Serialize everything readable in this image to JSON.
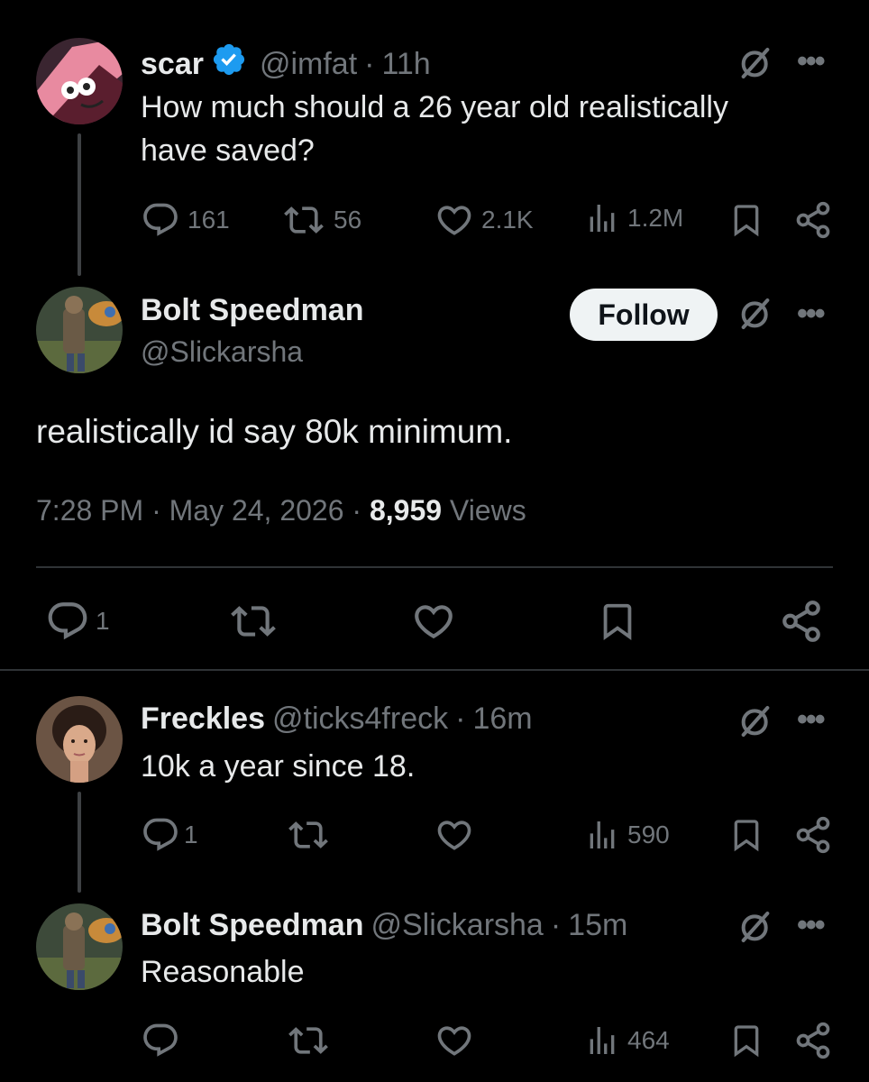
{
  "tweet1": {
    "name": "scar",
    "handle": "@imfat",
    "sep": "·",
    "time": "11h",
    "text_line1": "How much should a 26 year old realistically",
    "text_line2": "have saved?",
    "replies": "161",
    "reposts": "56",
    "likes": "2.1K",
    "views": "1.2M"
  },
  "main_tweet": {
    "name": "Bolt Speedman",
    "handle": "@Slickarsha",
    "follow_label": "Follow",
    "text": "realistically id say 80k minimum.",
    "time": "7:28 PM",
    "sep1": "·",
    "date": "May 24, 2026",
    "sep2": "·",
    "views_count": "8,959",
    "views_label": "Views",
    "replies": "1"
  },
  "reply1": {
    "name": "Freckles",
    "handle": "@ticks4freck",
    "sep": "·",
    "time": "16m",
    "text": "10k a year since 18.",
    "replies": "1",
    "views": "590"
  },
  "reply2": {
    "name": "Bolt Speedman",
    "handle": "@Slickarsha",
    "sep": "·",
    "time": "15m",
    "text": "Reasonable",
    "views": "464"
  },
  "icons": {
    "reply": "reply-icon",
    "repost": "repost-icon",
    "like": "heart-icon",
    "views": "views-icon",
    "bookmark": "bookmark-icon",
    "share": "share-icon",
    "grok": "grok-icon",
    "more": "more-icon",
    "verified": "verified-badge-icon"
  },
  "colors": {
    "background": "#000000",
    "text": "#e7e9ea",
    "secondary": "#71767b",
    "verified": "#1d9bf0",
    "follow_bg": "#eff3f4"
  },
  "more_glyph": "•••"
}
